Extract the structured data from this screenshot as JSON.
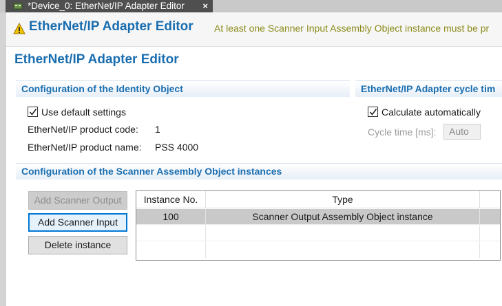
{
  "tab": {
    "title": "*Device_0: EtherNet/IP Adapter Editor",
    "close": "×"
  },
  "header": {
    "title": "EtherNet/IP Adapter Editor",
    "message": "At least one Scanner Input Assembly Object instance must be pr"
  },
  "page_title": "EtherNet/IP Adapter Editor",
  "identity": {
    "section_title": "Configuration of the Identity Object",
    "use_default_label": "Use default settings",
    "use_default_checked": true,
    "product_code_label": "EtherNet/IP product code:",
    "product_code_value": "1",
    "product_name_label": "EtherNet/IP product name:",
    "product_name_value": "PSS 4000"
  },
  "cycle": {
    "section_title": "EtherNet/IP Adapter cycle tim",
    "calc_label": "Calculate automatically",
    "calc_checked": true,
    "cycle_time_label": "Cycle time [ms]:",
    "cycle_time_value": "Auto"
  },
  "scanner": {
    "section_title": "Configuration of the Scanner Assembly Object instances",
    "buttons": {
      "add_output": "Add Scanner Output",
      "add_input": "Add Scanner Input",
      "delete": "Delete instance"
    },
    "table": {
      "columns": [
        "Instance No.",
        "Type"
      ],
      "rows": [
        {
          "instance": "100",
          "type": "Scanner Output Assembly Object instance"
        }
      ]
    }
  },
  "colors": {
    "accent": "#1a6eb0",
    "warning_text": "#8a8a1a",
    "tab_active": "#4f4f4f",
    "selected_row": "#c9c9c9"
  }
}
